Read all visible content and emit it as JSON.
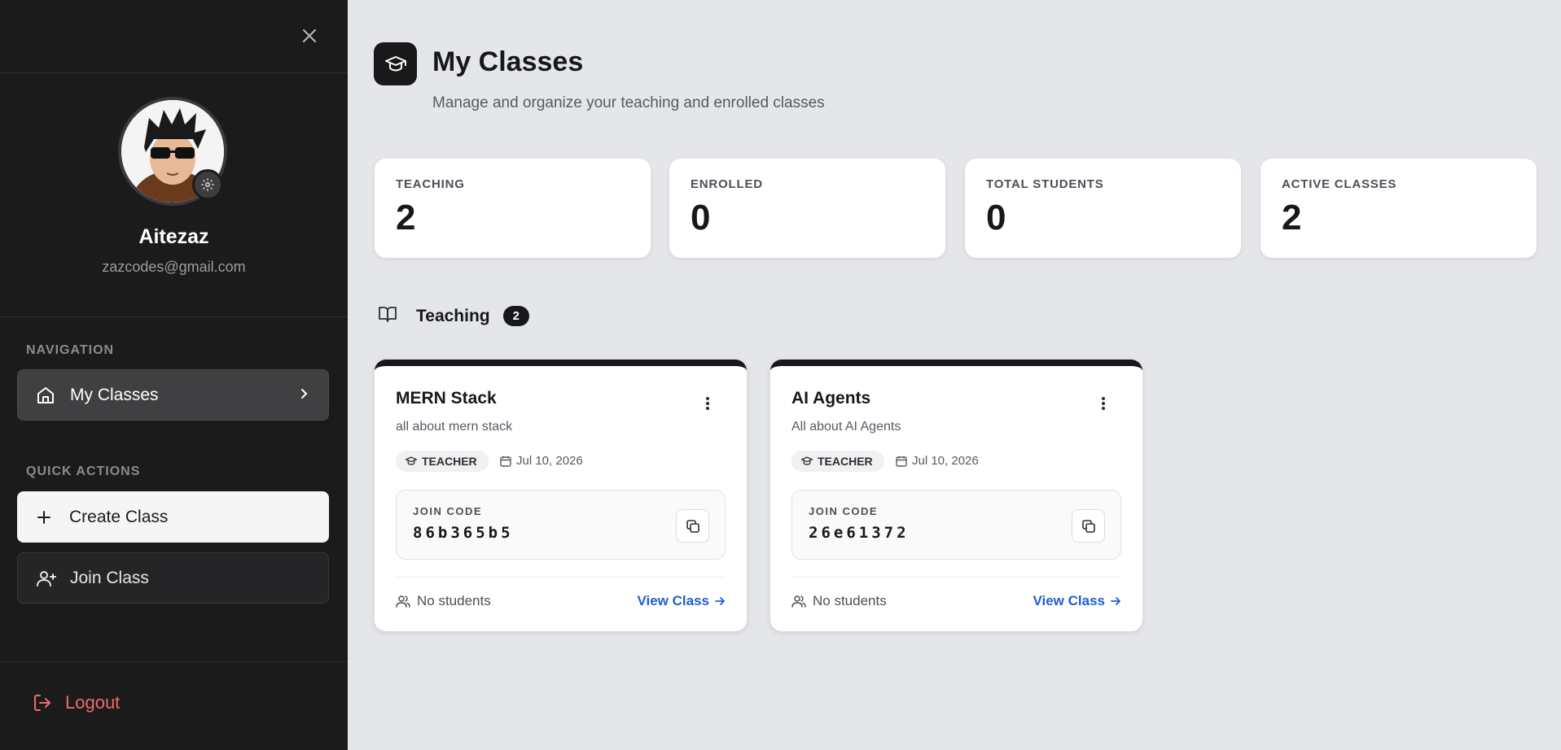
{
  "sidebar": {
    "user": {
      "name": "Aitezaz",
      "email": "zazcodes@gmail.com"
    },
    "navigation_heading": "NAVIGATION",
    "nav_items": [
      {
        "label": "My Classes",
        "icon": "home-icon",
        "active": true
      }
    ],
    "quick_actions_heading": "QUICK ACTIONS",
    "quick_actions": [
      {
        "label": "Create Class",
        "icon": "plus-icon"
      },
      {
        "label": "Join Class",
        "icon": "user-plus-icon"
      }
    ],
    "logout_label": "Logout"
  },
  "header": {
    "title": "My Classes",
    "subtitle": "Manage and organize your teaching and enrolled classes"
  },
  "stats": [
    {
      "label": "TEACHING",
      "value": "2"
    },
    {
      "label": "ENROLLED",
      "value": "0"
    },
    {
      "label": "TOTAL STUDENTS",
      "value": "0"
    },
    {
      "label": "ACTIVE CLASSES",
      "value": "2"
    }
  ],
  "teaching_section": {
    "title": "Teaching",
    "count": "2"
  },
  "classes": [
    {
      "title": "MERN Stack",
      "description": "all about mern stack",
      "role": "TEACHER",
      "date": "Jul 10, 2026",
      "join_code_label": "JOIN CODE",
      "join_code": "86b365b5",
      "students": "No students",
      "view_label": "View Class"
    },
    {
      "title": "AI Agents",
      "description": "All about AI Agents",
      "role": "TEACHER",
      "date": "Jul 10, 2026",
      "join_code_label": "JOIN CODE",
      "join_code": "26e61372",
      "students": "No students",
      "view_label": "View Class"
    }
  ],
  "colors": {
    "sidebar_bg": "#1b1b1c",
    "main_bg": "#e5e6ea",
    "accent_link": "#1d5fd4",
    "logout": "#f06a6a"
  }
}
